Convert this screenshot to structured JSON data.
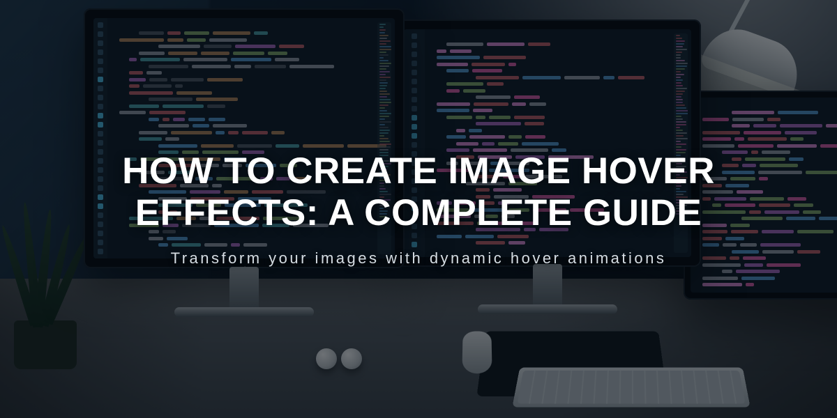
{
  "hero": {
    "title": "HOW TO CREATE IMAGE HOVER EFFECTS: A COMPLETE GUIDE",
    "subtitle": "Transform your images with dynamic hover animations"
  },
  "code_colors": {
    "keyword": "#c678dd",
    "string": "#98c379",
    "func": "#61afef",
    "num": "#d19a66",
    "comment": "#5c6370",
    "text": "#abb2bf",
    "accentA": "#e06c75",
    "accentB": "#56b6c2",
    "pinkA": "#ff6ac1",
    "pinkB": "#ff9ff3"
  }
}
